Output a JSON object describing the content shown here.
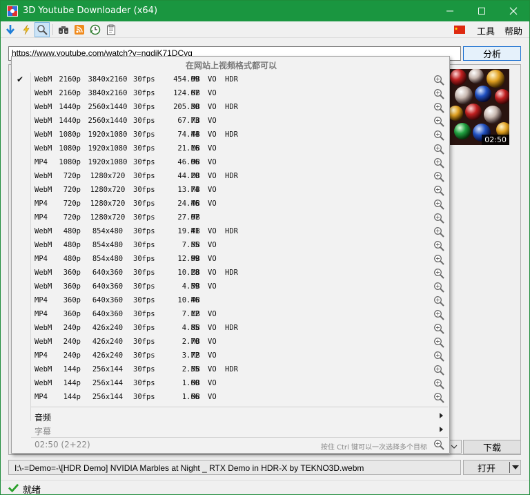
{
  "window": {
    "title": "3D Youtube Downloader (x64)",
    "minimize_label": "minimize",
    "maximize_label": "maximize",
    "close_label": "close"
  },
  "toolbar": {
    "icons": [
      "download-icon",
      "lightning-icon",
      "search-icon",
      "binoculars-icon",
      "rss-icon",
      "clock-icon",
      "clipboard-icon"
    ],
    "menu": {
      "tools": "工具",
      "help": "帮助"
    },
    "language_flag": "china-flag-icon"
  },
  "url": {
    "value": "https://www.youtube.com/watch?v=nqdiK71DCvg",
    "analyze_label": "分析"
  },
  "thumbnail": {
    "duration": "02:50"
  },
  "popup": {
    "header": "在网站上视频格式都可以",
    "formats": [
      {
        "checked": "✔",
        "container": "WebM",
        "res": "2160p",
        "dim": "3840x2160",
        "fps": "30fps",
        "size": "454.09",
        "unit": "MB",
        "vo": "VO",
        "hdr": "HDR"
      },
      {
        "checked": "",
        "container": "WebM",
        "res": "2160p",
        "dim": "3840x2160",
        "fps": "30fps",
        "size": "124.67",
        "unit": "MB",
        "vo": "VO",
        "hdr": ""
      },
      {
        "checked": "",
        "container": "WebM",
        "res": "1440p",
        "dim": "2560x1440",
        "fps": "30fps",
        "size": "205.30",
        "unit": "MB",
        "vo": "VO",
        "hdr": "HDR"
      },
      {
        "checked": "",
        "container": "WebM",
        "res": "1440p",
        "dim": "2560x1440",
        "fps": "30fps",
        "size": "67.73",
        "unit": "MB",
        "vo": "VO",
        "hdr": ""
      },
      {
        "checked": "",
        "container": "WebM",
        "res": "1080p",
        "dim": "1920x1080",
        "fps": "30fps",
        "size": "74.44",
        "unit": "MB",
        "vo": "VO",
        "hdr": "HDR"
      },
      {
        "checked": "",
        "container": "WebM",
        "res": "1080p",
        "dim": "1920x1080",
        "fps": "30fps",
        "size": "21.16",
        "unit": "MB",
        "vo": "VO",
        "hdr": ""
      },
      {
        "checked": "",
        "container": "MP4",
        "res": "1080p",
        "dim": "1920x1080",
        "fps": "30fps",
        "size": "46.06",
        "unit": "MB",
        "vo": "VO",
        "hdr": ""
      },
      {
        "checked": "",
        "container": "WebM",
        "res": "720p",
        "dim": "1280x720",
        "fps": "30fps",
        "size": "44.20",
        "unit": "MB",
        "vo": "VO",
        "hdr": "HDR"
      },
      {
        "checked": "",
        "container": "WebM",
        "res": "720p",
        "dim": "1280x720",
        "fps": "30fps",
        "size": "13.74",
        "unit": "MB",
        "vo": "VO",
        "hdr": ""
      },
      {
        "checked": "",
        "container": "MP4",
        "res": "720p",
        "dim": "1280x720",
        "fps": "30fps",
        "size": "24.46",
        "unit": "MB",
        "vo": "VO",
        "hdr": ""
      },
      {
        "checked": "",
        "container": "MP4",
        "res": "720p",
        "dim": "1280x720",
        "fps": "30fps",
        "size": "27.07",
        "unit": "MB",
        "vo": "",
        "hdr": ""
      },
      {
        "checked": "",
        "container": "WebM",
        "res": "480p",
        "dim": "854x480",
        "fps": "30fps",
        "size": "19.41",
        "unit": "MB",
        "vo": "VO",
        "hdr": "HDR"
      },
      {
        "checked": "",
        "container": "WebM",
        "res": "480p",
        "dim": "854x480",
        "fps": "30fps",
        "size": "7.55",
        "unit": "MB",
        "vo": "VO",
        "hdr": ""
      },
      {
        "checked": "",
        "container": "MP4",
        "res": "480p",
        "dim": "854x480",
        "fps": "30fps",
        "size": "12.99",
        "unit": "MB",
        "vo": "VO",
        "hdr": ""
      },
      {
        "checked": "",
        "container": "WebM",
        "res": "360p",
        "dim": "640x360",
        "fps": "30fps",
        "size": "10.28",
        "unit": "MB",
        "vo": "VO",
        "hdr": "HDR"
      },
      {
        "checked": "",
        "container": "WebM",
        "res": "360p",
        "dim": "640x360",
        "fps": "30fps",
        "size": "4.59",
        "unit": "MB",
        "vo": "VO",
        "hdr": ""
      },
      {
        "checked": "",
        "container": "MP4",
        "res": "360p",
        "dim": "640x360",
        "fps": "30fps",
        "size": "10.46",
        "unit": "MB",
        "vo": "",
        "hdr": ""
      },
      {
        "checked": "",
        "container": "MP4",
        "res": "360p",
        "dim": "640x360",
        "fps": "30fps",
        "size": "7.12",
        "unit": "MB",
        "vo": "VO",
        "hdr": ""
      },
      {
        "checked": "",
        "container": "WebM",
        "res": "240p",
        "dim": "426x240",
        "fps": "30fps",
        "size": "4.85",
        "unit": "MB",
        "vo": "VO",
        "hdr": "HDR"
      },
      {
        "checked": "",
        "container": "WebM",
        "res": "240p",
        "dim": "426x240",
        "fps": "30fps",
        "size": "2.70",
        "unit": "MB",
        "vo": "VO",
        "hdr": ""
      },
      {
        "checked": "",
        "container": "MP4",
        "res": "240p",
        "dim": "426x240",
        "fps": "30fps",
        "size": "3.72",
        "unit": "MB",
        "vo": "VO",
        "hdr": ""
      },
      {
        "checked": "",
        "container": "WebM",
        "res": "144p",
        "dim": "256x144",
        "fps": "30fps",
        "size": "2.55",
        "unit": "MB",
        "vo": "VO",
        "hdr": "HDR"
      },
      {
        "checked": "",
        "container": "WebM",
        "res": "144p",
        "dim": "256x144",
        "fps": "30fps",
        "size": "1.60",
        "unit": "MB",
        "vo": "VO",
        "hdr": ""
      },
      {
        "checked": "",
        "container": "MP4",
        "res": "144p",
        "dim": "256x144",
        "fps": "30fps",
        "size": "1.66",
        "unit": "MB",
        "vo": "VO",
        "hdr": ""
      }
    ],
    "audio_label": "音频",
    "subtitle_label": "字幕",
    "duration_count": "02:50 (2+22)",
    "multi_select_hint": "按住 Ctrl 键可以一次选择多个目标"
  },
  "download": {
    "label": "下载"
  },
  "output": {
    "path": "I:\\-=Demo=-\\[HDR Demo] NVIDIA Marbles at Night _ RTX Demo in HDR-X by TEKNO3D.webm",
    "open_label": "打开"
  },
  "status": {
    "text": "就绪"
  },
  "colors": {
    "titlebar": "#1a9640",
    "accent": "#1a6fd0"
  }
}
